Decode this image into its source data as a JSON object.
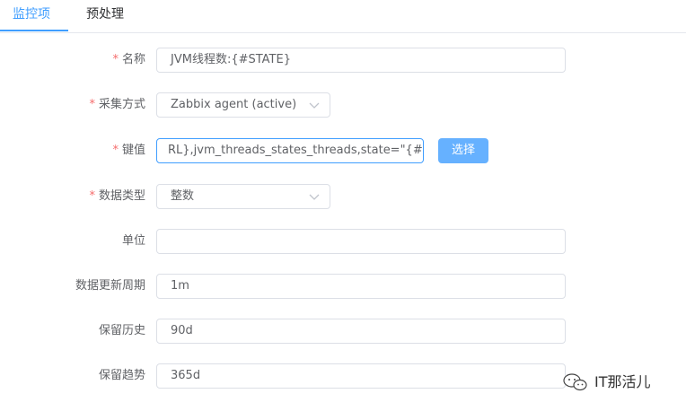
{
  "tabs": [
    {
      "label": "监控项",
      "active": true
    },
    {
      "label": "预处理",
      "active": false
    }
  ],
  "form": {
    "name": {
      "label": "名称",
      "required": true,
      "value": "JVM线程数:{#STATE}"
    },
    "type": {
      "label": "采集方式",
      "required": true,
      "value": "Zabbix agent (active)"
    },
    "key": {
      "label": "键值",
      "required": true,
      "value": "RL},jvm_threads_states_threads,state=\"{#STATE}\"]",
      "button": "选择"
    },
    "data_type": {
      "label": "数据类型",
      "required": true,
      "value": "整数"
    },
    "unit": {
      "label": "单位",
      "required": false,
      "value": ""
    },
    "interval": {
      "label": "数据更新周期",
      "required": false,
      "value": "1m"
    },
    "history": {
      "label": "保留历史",
      "required": false,
      "value": "90d"
    },
    "trends": {
      "label": "保留趋势",
      "required": false,
      "value": "365d"
    }
  },
  "watermark": {
    "text": "IT那活儿",
    "icon": "wechat-icon"
  },
  "colors": {
    "accent": "#409eff",
    "button": "#66b1ff",
    "required": "#f56c6c",
    "border": "#dcdfe6"
  }
}
